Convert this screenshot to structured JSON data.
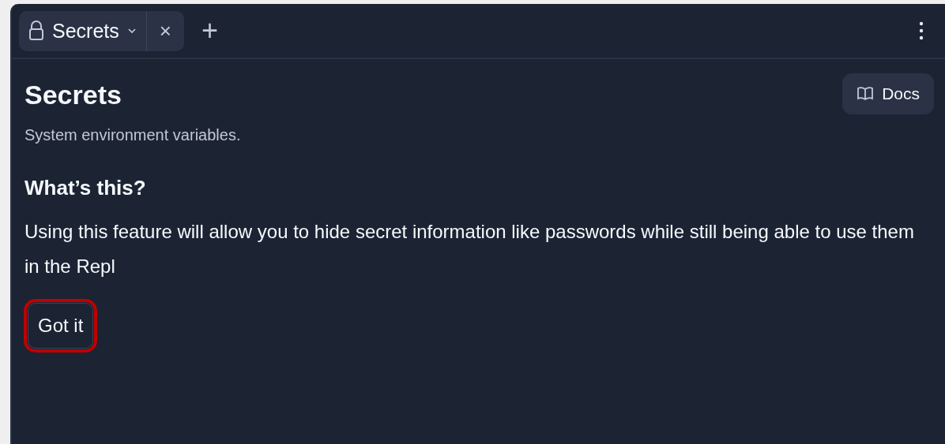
{
  "tab": {
    "label": "Secrets",
    "close": "×",
    "selected": true
  },
  "new_tab": "+",
  "header": {
    "title": "Secrets",
    "subtitle": "System environment variables.",
    "docs_button": "Docs"
  },
  "info": {
    "heading": "What’s this?",
    "body": "Using this feature will allow you to hide secret information like passwords while still being able to use them in the Repl",
    "button": {
      "label": "Got it",
      "highlighted": true
    }
  }
}
